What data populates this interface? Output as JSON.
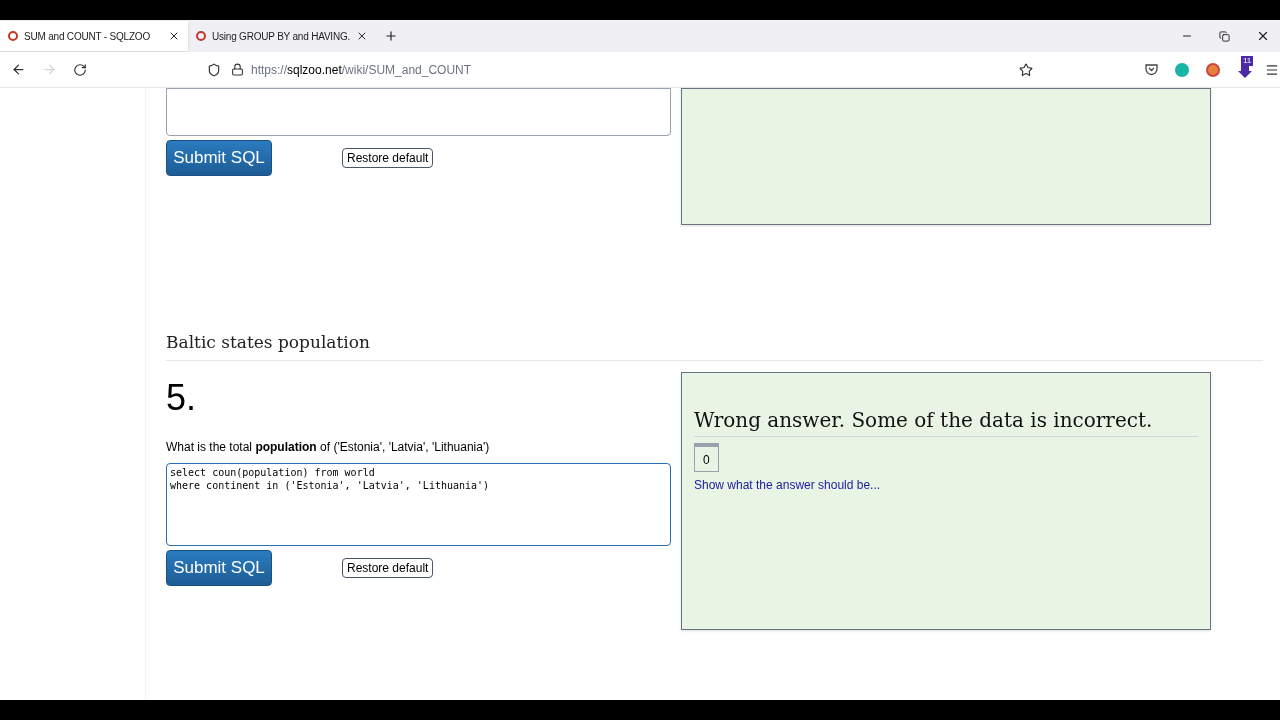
{
  "tabs": [
    {
      "title": "SUM and COUNT - SQLZOO",
      "selected": true
    },
    {
      "title": "Using GROUP BY and HAVING.",
      "selected": false
    }
  ],
  "address": {
    "scheme": "https://",
    "domain": "sqlzoo.net",
    "path": "/wiki/SUM_and_COUNT"
  },
  "extension_badge": "11",
  "previous_exercise": {
    "submit": "Submit SQL",
    "restore": "Restore default"
  },
  "section_heading": "Baltic states population",
  "exercise": {
    "number": "5.",
    "question": "What is the total **population** of ('Estonia', 'Latvia', 'Lithuania')",
    "query": "select coun(population) from world\nwhere continent in ('Estonia', 'Latvia', 'Lithuania')",
    "submit": "Submit SQL",
    "restore": "Restore default"
  },
  "result": {
    "message": "Wrong answer. Some of the data is incorrect.",
    "cells": [
      "0"
    ],
    "link": "Show what the answer should be..."
  }
}
